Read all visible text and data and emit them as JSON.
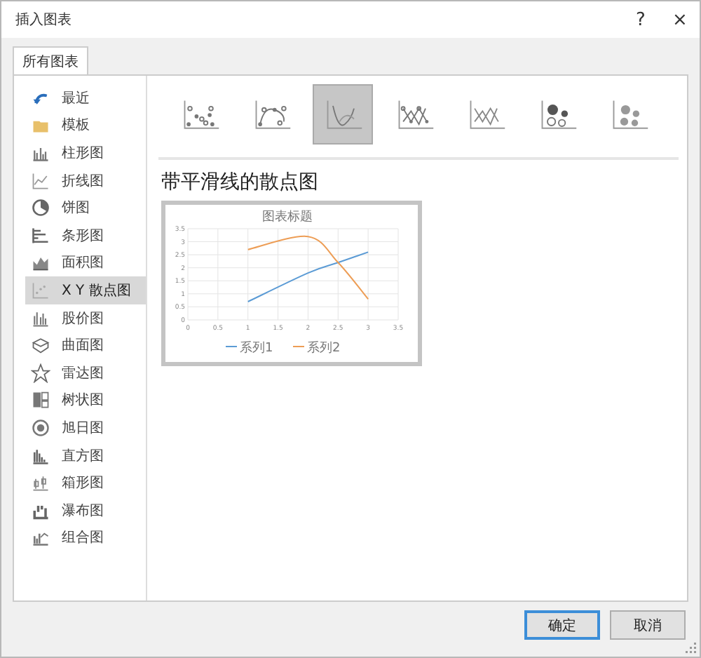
{
  "window": {
    "title": "插入图表",
    "help": "?",
    "close": "×"
  },
  "tabs": [
    {
      "label": "所有图表",
      "selected": true
    }
  ],
  "sidebar": {
    "items": [
      {
        "label": "最近",
        "selected": false
      },
      {
        "label": "模板",
        "selected": false
      },
      {
        "label": "柱形图",
        "selected": false
      },
      {
        "label": "折线图",
        "selected": false
      },
      {
        "label": "饼图",
        "selected": false
      },
      {
        "label": "条形图",
        "selected": false
      },
      {
        "label": "面积图",
        "selected": false
      },
      {
        "label": "X Y 散点图",
        "selected": true
      },
      {
        "label": "股价图",
        "selected": false
      },
      {
        "label": "曲面图",
        "selected": false
      },
      {
        "label": "雷达图",
        "selected": false
      },
      {
        "label": "树状图",
        "selected": false
      },
      {
        "label": "旭日图",
        "selected": false
      },
      {
        "label": "直方图",
        "selected": false
      },
      {
        "label": "箱形图",
        "selected": false
      },
      {
        "label": "瀑布图",
        "selected": false
      },
      {
        "label": "组合图",
        "selected": false
      }
    ]
  },
  "subtypes": [
    {
      "selected": false
    },
    {
      "selected": false
    },
    {
      "selected": true
    },
    {
      "selected": false
    },
    {
      "selected": false
    },
    {
      "selected": false
    },
    {
      "selected": false
    }
  ],
  "heading": "带平滑线的散点图",
  "preview": {
    "chart_data": {
      "type": "line",
      "title": "图表标题",
      "x": [
        1,
        2,
        2.5,
        3
      ],
      "series": [
        {
          "name": "系列1",
          "color": "#5b9bd5",
          "values": [
            0.7,
            1.8,
            2.2,
            2.6
          ]
        },
        {
          "name": "系列2",
          "color": "#ed9d55",
          "values": [
            2.7,
            3.2,
            2.2,
            0.8
          ]
        }
      ],
      "xlim": [
        0,
        3.5
      ],
      "ylim": [
        0,
        3.5
      ],
      "xticks": [
        0,
        0.5,
        1,
        1.5,
        2,
        2.5,
        3,
        3.5
      ],
      "yticks": [
        0,
        0.5,
        1,
        1.5,
        2,
        2.5,
        3,
        3.5
      ],
      "grid": true,
      "legend": "bottom"
    }
  },
  "buttons": [
    {
      "label": "确定",
      "kind": "primary"
    },
    {
      "label": "取消",
      "kind": "secondary"
    }
  ]
}
